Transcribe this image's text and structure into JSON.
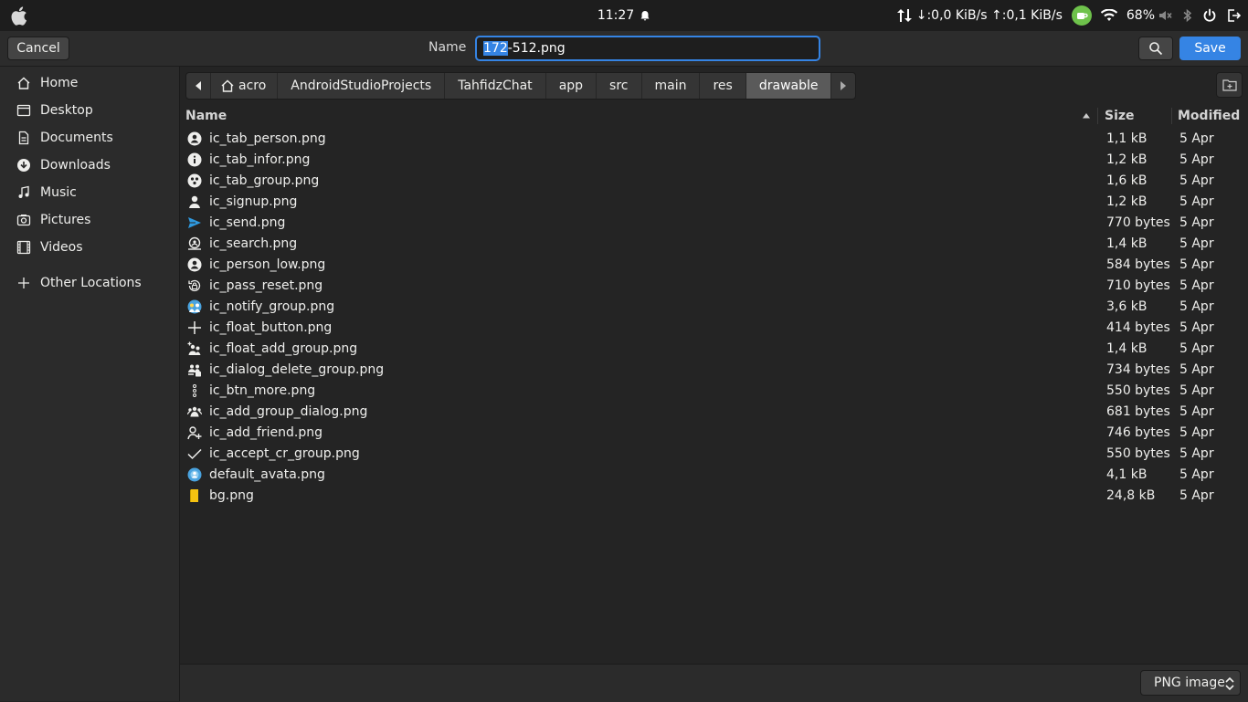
{
  "panel": {
    "clock": "11:27",
    "network_speed": "↓:0,0 KiB/s ↑:0,1 KiB/s",
    "battery": "68%"
  },
  "header": {
    "cancel_label": "Cancel",
    "name_label": "Name",
    "filename_selected": "172",
    "filename_rest": "-512.png",
    "save_label": "Save"
  },
  "sidebar": {
    "items": [
      {
        "label": "Home",
        "icon": "home-icon"
      },
      {
        "label": "Desktop",
        "icon": "desktop-icon"
      },
      {
        "label": "Documents",
        "icon": "documents-icon"
      },
      {
        "label": "Downloads",
        "icon": "downloads-icon"
      },
      {
        "label": "Music",
        "icon": "music-icon"
      },
      {
        "label": "Pictures",
        "icon": "pictures-icon"
      },
      {
        "label": "Videos",
        "icon": "videos-icon"
      },
      {
        "label": "Other Locations",
        "icon": "plus-icon"
      }
    ]
  },
  "pathbar": {
    "crumbs": [
      "acro",
      "AndroidStudioProjects",
      "TahfidzChat",
      "app",
      "src",
      "main",
      "res",
      "drawable"
    ],
    "active": "drawable"
  },
  "columns": {
    "name": "Name",
    "size": "Size",
    "modified": "Modified"
  },
  "files": [
    {
      "name": "ic_tab_person.png",
      "size": "1,1 kB",
      "modified": "5 Apr",
      "icon": "person-circle-icon"
    },
    {
      "name": "ic_tab_infor.png",
      "size": "1,2 kB",
      "modified": "5 Apr",
      "icon": "info-icon"
    },
    {
      "name": "ic_tab_group.png",
      "size": "1,6 kB",
      "modified": "5 Apr",
      "icon": "group-circle-icon"
    },
    {
      "name": "ic_signup.png",
      "size": "1,2 kB",
      "modified": "5 Apr",
      "icon": "signup-icon"
    },
    {
      "name": "ic_send.png",
      "size": "770 bytes",
      "modified": "5 Apr",
      "icon": "send-icon"
    },
    {
      "name": "ic_search.png",
      "size": "1,4 kB",
      "modified": "5 Apr",
      "icon": "search-people-icon"
    },
    {
      "name": "ic_person_low.png",
      "size": "584 bytes",
      "modified": "5 Apr",
      "icon": "person-circle-icon"
    },
    {
      "name": "ic_pass_reset.png",
      "size": "710 bytes",
      "modified": "5 Apr",
      "icon": "lock-reset-icon"
    },
    {
      "name": "ic_notify_group.png",
      "size": "3,6 kB",
      "modified": "5 Apr",
      "icon": "notify-group-icon"
    },
    {
      "name": "ic_float_button.png",
      "size": "414 bytes",
      "modified": "5 Apr",
      "icon": "plus-icon"
    },
    {
      "name": "ic_float_add_group.png",
      "size": "1,4 kB",
      "modified": "5 Apr",
      "icon": "add-group-icon"
    },
    {
      "name": "ic_dialog_delete_group.png",
      "size": "734 bytes",
      "modified": "5 Apr",
      "icon": "delete-group-icon"
    },
    {
      "name": "ic_btn_more.png",
      "size": "550 bytes",
      "modified": "5 Apr",
      "icon": "more-vertical-icon"
    },
    {
      "name": "ic_add_group_dialog.png",
      "size": "681 bytes",
      "modified": "5 Apr",
      "icon": "group-icon"
    },
    {
      "name": "ic_add_friend.png",
      "size": "746 bytes",
      "modified": "5 Apr",
      "icon": "add-friend-icon"
    },
    {
      "name": "ic_accept_cr_group.png",
      "size": "550 bytes",
      "modified": "5 Apr",
      "icon": "checkmark-icon"
    },
    {
      "name": "default_avata.png",
      "size": "4,1 kB",
      "modified": "5 Apr",
      "icon": "avatar-globe-icon"
    },
    {
      "name": "bg.png",
      "size": "24,8 kB",
      "modified": "5 Apr",
      "icon": "yellow-image-icon"
    }
  ],
  "filter": {
    "label": "PNG image"
  },
  "colors": {
    "accent": "#3584e4",
    "background": "#242424",
    "sidebar": "#2b2b2b",
    "active_crumb": "#5a5a5a"
  }
}
